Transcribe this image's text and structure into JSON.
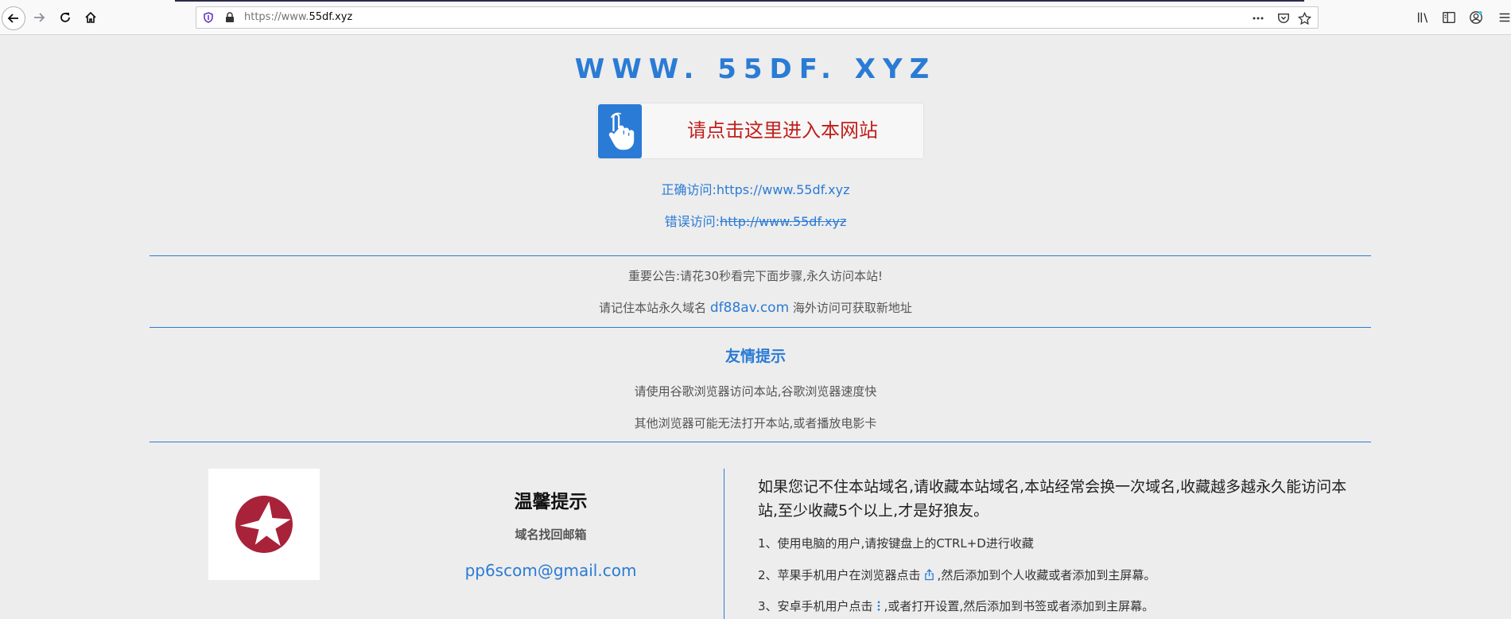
{
  "browser": {
    "url_scheme": "https://www.",
    "url_host": "55df.xyz"
  },
  "site": {
    "title": "WWW. 55DF. XYZ",
    "enter_label": "请点击这里进入本网站",
    "correct_label": "正确访问:",
    "correct_url": "https://www.55df.xyz",
    "wrong_label": "错误访问:",
    "wrong_url": "http://www.55df.xyz"
  },
  "notice": {
    "line1": "重要公告:请花30秒看完下面步骤,永久访问本站!",
    "line2_prefix": "请记住本站永久域名 ",
    "permanent_domain": "df88av.com",
    "line2_suffix": " 海外访问可获取新地址"
  },
  "tips": {
    "title": "友情提示",
    "line1": "请使用谷歌浏览器访问本站,谷歌浏览器速度快",
    "line2": "其他浏览器可能无法打开本站,或者播放电影卡"
  },
  "warm": {
    "title": "温馨提示",
    "recover_label": "域名找回邮箱",
    "email": "pp6scom@gmail.com"
  },
  "bookmark": {
    "intro": "如果您记不住本站域名,请收藏本站域名,本站经常会换一次域名,收藏越多越永久能访问本站,至少收藏5个以上,才是好狼友。",
    "step1": "1、使用电脑的用户,请按键盘上的CTRL+D进行收藏",
    "step2_prefix": "2、苹果手机用户在浏览器点击",
    "step2_suffix": ",然后添加到个人收藏或者添加到主屏幕。",
    "step3_prefix": "3、安卓手机用户点击",
    "step3_suffix": ",或者打开设置,然后添加到书签或者添加到主屏幕。"
  },
  "colors": {
    "accent": "#2a7bd5",
    "enter_text": "#c0201c",
    "logo_red": "#a8223a"
  },
  "icons": [
    "back-icon",
    "forward-icon",
    "reload-icon",
    "home-icon",
    "shield-icon",
    "lock-icon",
    "page-actions-icon",
    "pocket-icon",
    "bookmark-star-icon",
    "library-icon",
    "sidebar-icon",
    "account-icon",
    "menu-icon",
    "hand-pointer-icon",
    "share-icon",
    "kebab-menu-icon"
  ]
}
